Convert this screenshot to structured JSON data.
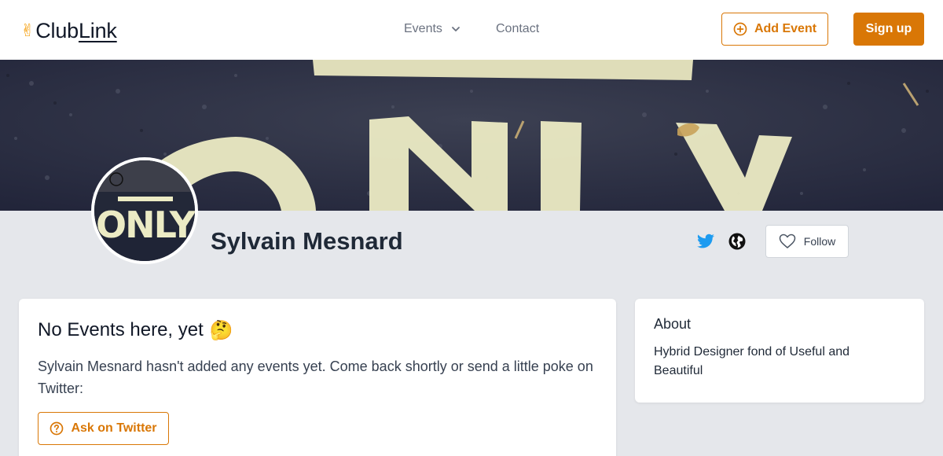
{
  "header": {
    "logo_icon": "victory-hand-icon",
    "logo_part1": "Club",
    "logo_part2": "Link",
    "nav": {
      "events_label": "Events",
      "contact_label": "Contact"
    },
    "add_event_label": "Add Event",
    "signup_label": "Sign up"
  },
  "banner": {
    "painted_text": "ONLY"
  },
  "profile": {
    "name": "Sylvain Mesnard",
    "avatar_text": "ONLY",
    "twitter_icon": "twitter-icon",
    "website_icon": "globe-icon",
    "follow_label": "Follow"
  },
  "main_card": {
    "title": "No Events here, yet",
    "title_emoji": "🤔",
    "description": "Sylvain Mesnard hasn't added any events yet. Come back shortly or send a little poke on Twitter:",
    "ask_label": "Ask on Twitter"
  },
  "about_card": {
    "heading": "About",
    "text": "Hybrid Designer fond of Useful and Beautiful"
  },
  "colors": {
    "accent": "#d97706",
    "twitter": "#1d9bf0",
    "page_bg": "#e5e7eb",
    "banner_dark": "#2b2e3e",
    "paint": "#ecebc4"
  }
}
